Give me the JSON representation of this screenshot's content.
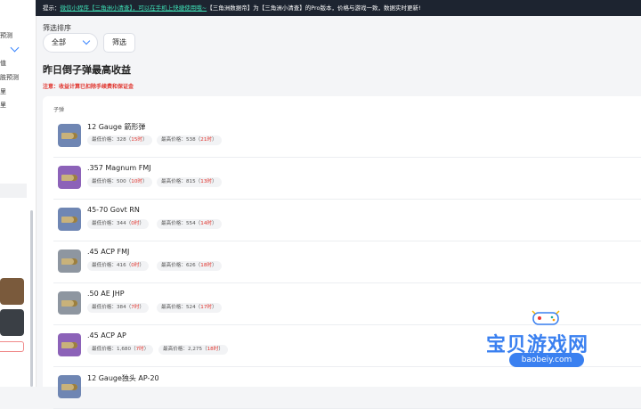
{
  "topbar": {
    "prefix": "提示：",
    "link": "微信小程序【三角洲小清查】，可以在手机上快捷使用哦~",
    "suffix": "【三角洲数据帝】为【三角洲小清查】的Pro版本，价格与游戏一致，数据实时更新!"
  },
  "sidebar": {
    "items": [
      "预测",
      "",
      "值",
      "肢预测",
      "里",
      "里"
    ]
  },
  "filter": {
    "label": "筛选排序",
    "select_value": "全部",
    "button_label": "筛选"
  },
  "page": {
    "title": "昨日倒子弹最高收益",
    "notice": "注意：收益计算已扣除手续费和保证金"
  },
  "table": {
    "column_header": "子弹",
    "low_label": "最低价格：",
    "high_label": "最高价格：",
    "rows": [
      {
        "name": "12 Gauge 箭形弹",
        "low": "328",
        "low_hour": "15时",
        "high": "538",
        "high_hour": "21时",
        "icon": "shotgun-shell-icon",
        "icon_color": "blue"
      },
      {
        "name": ".357 Magnum FMJ",
        "low": "500",
        "low_hour": "10时",
        "high": "815",
        "high_hour": "13时",
        "icon": "bullet-icon",
        "icon_color": "purple"
      },
      {
        "name": "45-70 Govt RN",
        "low": "344",
        "low_hour": "0时",
        "high": "554",
        "high_hour": "14时",
        "icon": "bullet-icon",
        "icon_color": "blue"
      },
      {
        "name": ".45 ACP FMJ",
        "low": "416",
        "low_hour": "0时",
        "high": "626",
        "high_hour": "18时",
        "icon": "bullet-icon",
        "icon_color": "gray"
      },
      {
        "name": ".50 AE JHP",
        "low": "384",
        "low_hour": "7时",
        "high": "524",
        "high_hour": "17时",
        "icon": "bullet-icon",
        "icon_color": "gray"
      },
      {
        "name": ".45 ACP AP",
        "low": "1,680",
        "low_hour": "7时",
        "high": "2,275",
        "high_hour": "18时",
        "icon": "bullet-icon",
        "icon_color": "purple"
      },
      {
        "name": "12 Gauge独头 AP-20",
        "low": "",
        "low_hour": "",
        "high": "",
        "high_hour": "",
        "icon": "shotgun-shell-icon",
        "icon_color": "blue"
      }
    ]
  },
  "watermark": {
    "title": "宝贝游戏网",
    "url": "baobeiy.com"
  }
}
